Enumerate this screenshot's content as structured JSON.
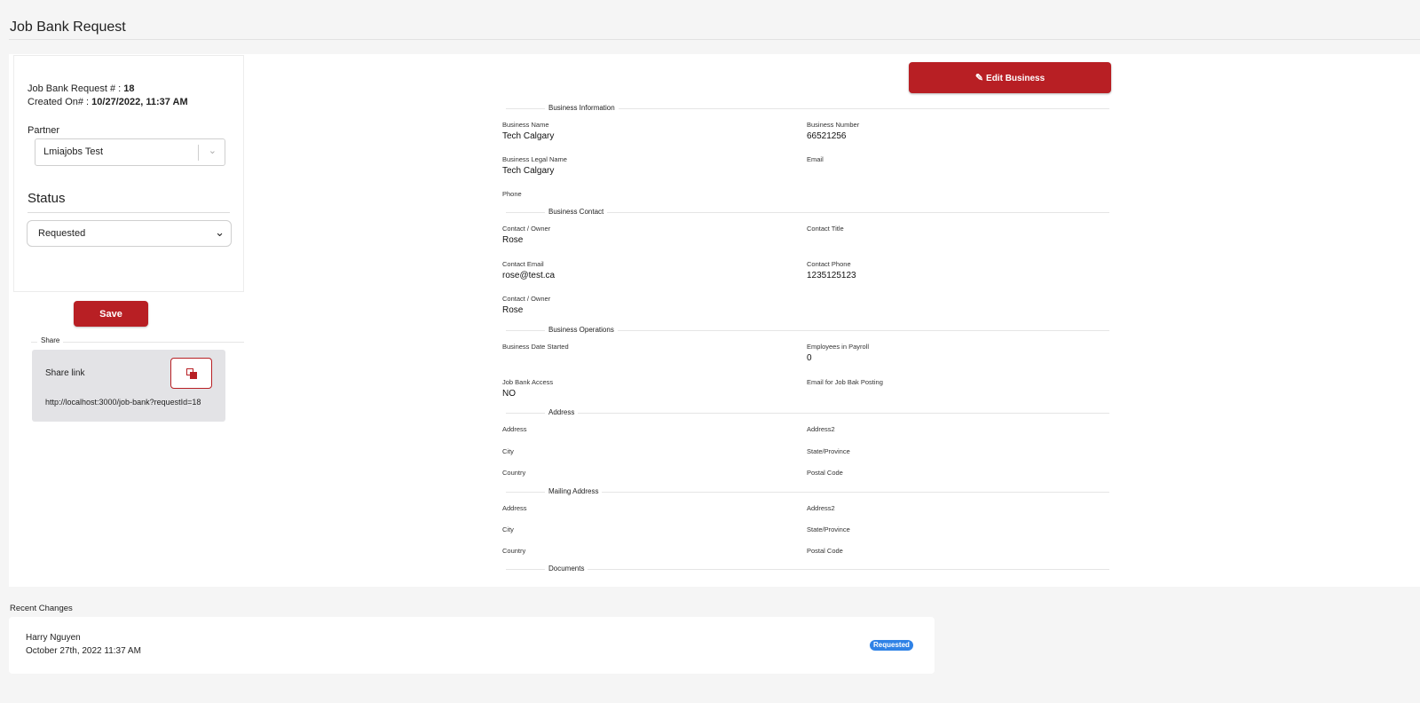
{
  "page": {
    "title": "Job Bank Request"
  },
  "request": {
    "number_label": "Job Bank Request # : ",
    "number_value": "18",
    "created_label": "Created On# : ",
    "created_value": "10/27/2022, 11:37 AM"
  },
  "partner": {
    "label": "Partner",
    "value": "Lmiajobs Test"
  },
  "status": {
    "label": "Status",
    "value": "Requested"
  },
  "actions": {
    "save_label": "Save",
    "edit_business_label": "Edit Business"
  },
  "share": {
    "legend": "Share",
    "link_label": "Share link",
    "url": "http://localhost:3000/job-bank?requestId=18"
  },
  "sections": {
    "business_information": "Business Information",
    "business_contact": "Business Contact",
    "business_operations": "Business Operations",
    "address": "Address",
    "mailing_address": "Mailing Address",
    "documents": "Documents"
  },
  "business_info": {
    "name_label": "Business Name",
    "name_value": "Tech Calgary",
    "number_label": "Business Number",
    "number_value": "66521256",
    "legal_label": "Business Legal Name",
    "legal_value": "Tech Calgary",
    "email_label": "Email",
    "email_value": "",
    "phone_label": "Phone",
    "phone_value": ""
  },
  "contact": {
    "owner_label": "Contact / Owner",
    "owner_value": "Rose",
    "title_label": "Contact Title",
    "title_value": "",
    "email_label": "Contact Email",
    "email_value": "rose@test.ca",
    "phone_label": "Contact Phone",
    "phone_value": "1235125123",
    "owner2_label": "Contact / Owner",
    "owner2_value": "Rose"
  },
  "operations": {
    "date_started_label": "Business Date Started",
    "date_started_value": "",
    "employees_label": "Employees in Payroll",
    "employees_value": "0",
    "jobbank_access_label": "Job Bank Access",
    "jobbank_access_value": "NO",
    "email_posting_label": "Email for Job Bak Posting",
    "email_posting_value": ""
  },
  "address": {
    "address_label": "Address",
    "address2_label": "Address2",
    "city_label": "City",
    "state_label": "State/Province",
    "country_label": "Country",
    "postal_label": "Postal Code"
  },
  "mailing": {
    "address_label": "Address",
    "address2_label": "Address2",
    "city_label": "City",
    "state_label": "State/Province",
    "country_label": "Country",
    "postal_label": "Postal Code"
  },
  "recent_changes": {
    "title": "Recent Changes",
    "items": [
      {
        "name": "Harry Nguyen",
        "date": "October 27th, 2022 11:37 AM",
        "status": "Requested"
      }
    ]
  },
  "colors": {
    "brand_red": "#b81f24",
    "badge_blue": "#2f82e6"
  }
}
